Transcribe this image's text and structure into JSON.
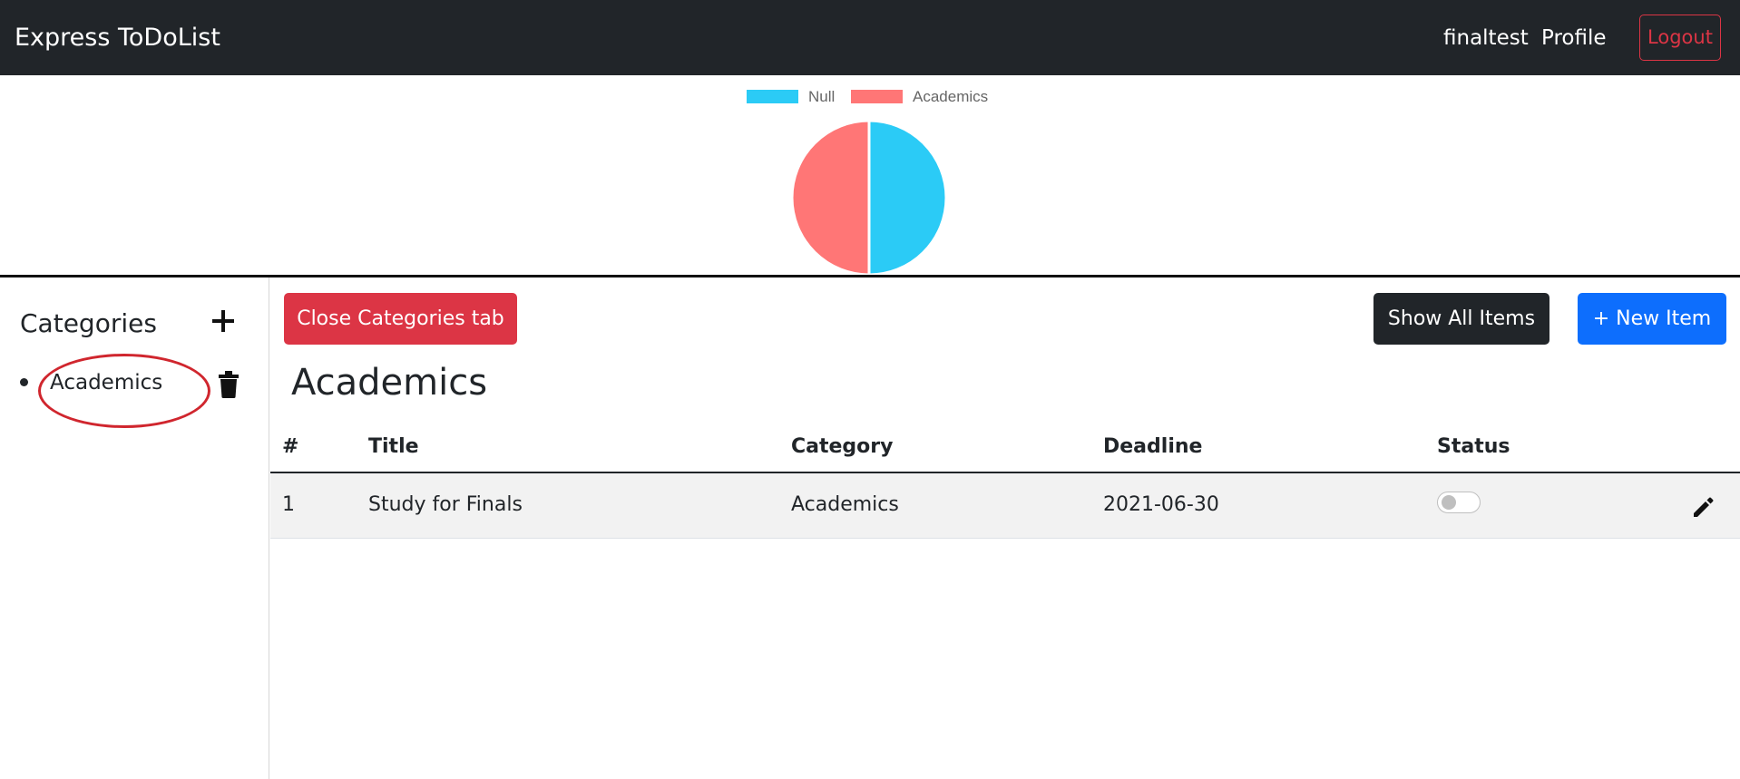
{
  "navbar": {
    "brand": "Express ToDoList",
    "username": "finaltest",
    "profile": "Profile",
    "logout": "Logout"
  },
  "chart_data": {
    "type": "pie",
    "legend": [
      "Null",
      "Academics"
    ],
    "labels": [
      "Null",
      "Academics"
    ],
    "values": [
      1,
      1
    ],
    "colors": [
      "#2bcbf6",
      "#ff7676"
    ],
    "legend_placement": "top"
  },
  "sidebar": {
    "title": "Categories",
    "items": [
      {
        "label": "Academics"
      }
    ]
  },
  "main": {
    "close_tab_label": "Close Categories tab",
    "show_all_label": "Show All Items",
    "new_item_label": "+ New Item",
    "section_title": "Academics",
    "table": {
      "headers": [
        "#",
        "Title",
        "Category",
        "Deadline",
        "Status"
      ],
      "rows": [
        {
          "num": "1",
          "title": "Study for Finals",
          "category": "Academics",
          "deadline": "2021-06-30",
          "status": false
        }
      ]
    }
  },
  "colors": {
    "navbar_bg": "#212529",
    "danger": "#dc3545",
    "primary": "#0d6efd",
    "dark": "#212529",
    "annotation": "#d0262e"
  }
}
